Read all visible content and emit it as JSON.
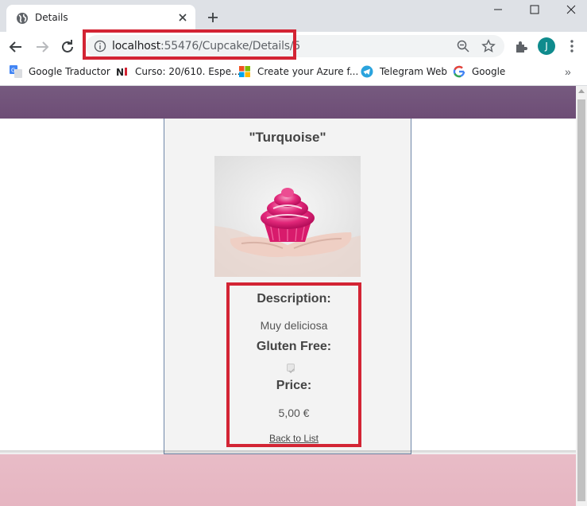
{
  "tab": {
    "title": "Details"
  },
  "address_bar": {
    "host": "localhost",
    "path": ":55476/Cupcake/Details/5",
    "avatar_letter": "J"
  },
  "bookmarks": {
    "items": [
      {
        "label": "Google Traductor",
        "icon": "google-translate-icon"
      },
      {
        "label": "Curso: 20/610. Espe...",
        "icon": "ni-logo-icon"
      },
      {
        "label": "Create your Azure f...",
        "icon": "microsoft-logo-icon"
      },
      {
        "label": "Telegram Web",
        "icon": "telegram-icon"
      },
      {
        "label": "Google",
        "icon": "google-g-icon"
      }
    ],
    "more": "»"
  },
  "product": {
    "title": "\"Turquoise\"",
    "description_label": "Description:",
    "description_value": "Muy deliciosa",
    "gluten_label": "Gluten Free:",
    "gluten_free": true,
    "price_label": "Price:",
    "price_value": "5,00 €",
    "back_link": "Back to List"
  },
  "colors": {
    "highlight": "#d32434",
    "header": "#6e4d76",
    "footer": "#e6b5c1",
    "card": "#f3f3f3"
  }
}
